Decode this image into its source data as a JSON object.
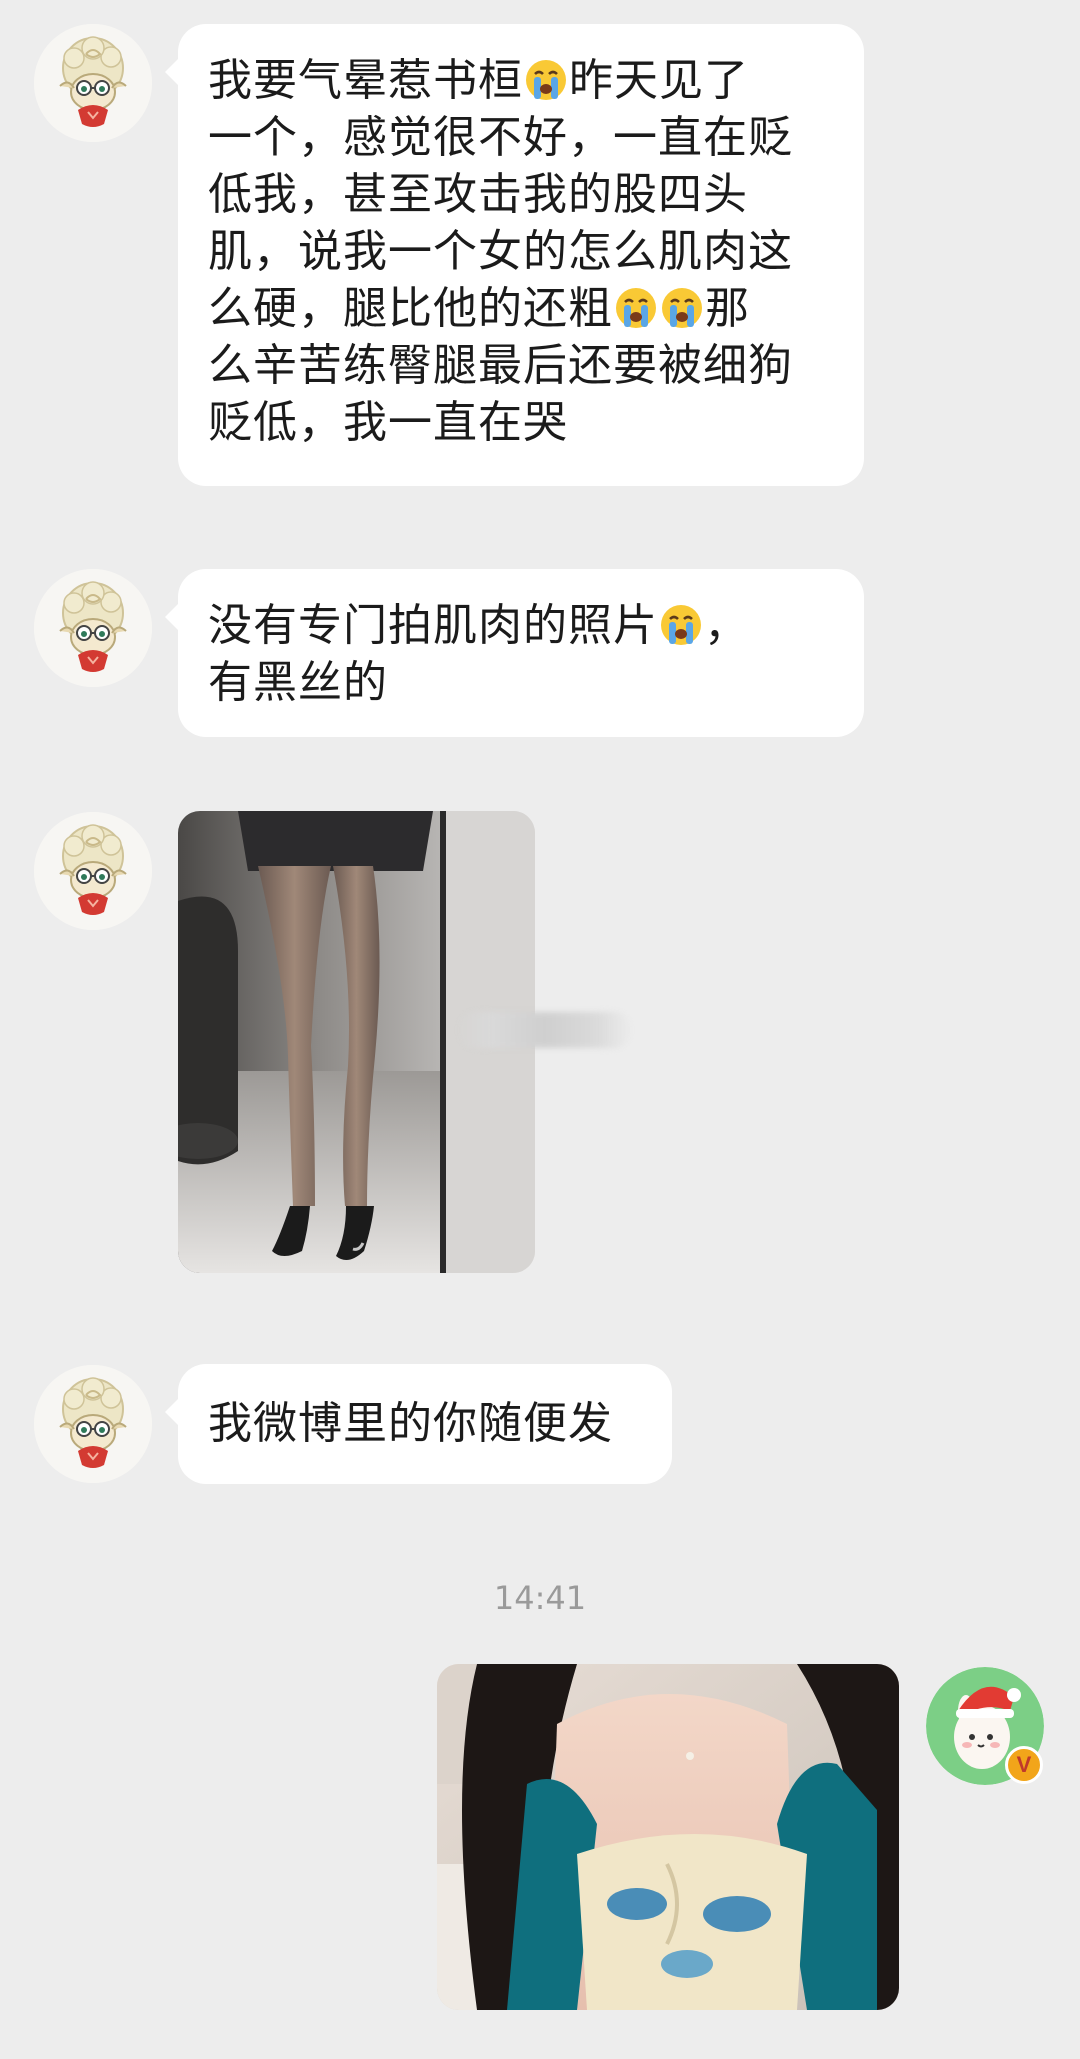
{
  "messages": [
    {
      "sender": "other",
      "lines": [
        "我要气晕惹书桓[cry]昨天见了",
        "一个，感觉很不好，一直在贬",
        "低我，甚至攻击我的股四头",
        "肌，说我一个女的怎么肌肉这",
        "么硬，腿比他的还粗[cry][cry]那",
        "么辛苦练臀腿最后还要被细狗",
        "贬低，我一直在哭"
      ]
    },
    {
      "sender": "other",
      "lines": [
        "没有专门拍肌肉的照片[cry]，",
        "有黑丝的"
      ]
    },
    {
      "sender": "other",
      "type": "image",
      "image_desc": "legs-in-black-stockings-photo"
    },
    {
      "sender": "other",
      "lines": [
        "我微博里的你随便发"
      ]
    },
    {
      "sender": "self",
      "type": "image",
      "image_desc": "selfie-photo"
    }
  ],
  "timestamp": "14:41",
  "avatars": {
    "other": "sheep-avatar-icon",
    "self": "santa-hat-bunny-avatar-icon",
    "self_badge": "V"
  },
  "colors": {
    "background": "#ededed",
    "bubble": "#ffffff",
    "verified_badge": "#f2a51a"
  }
}
